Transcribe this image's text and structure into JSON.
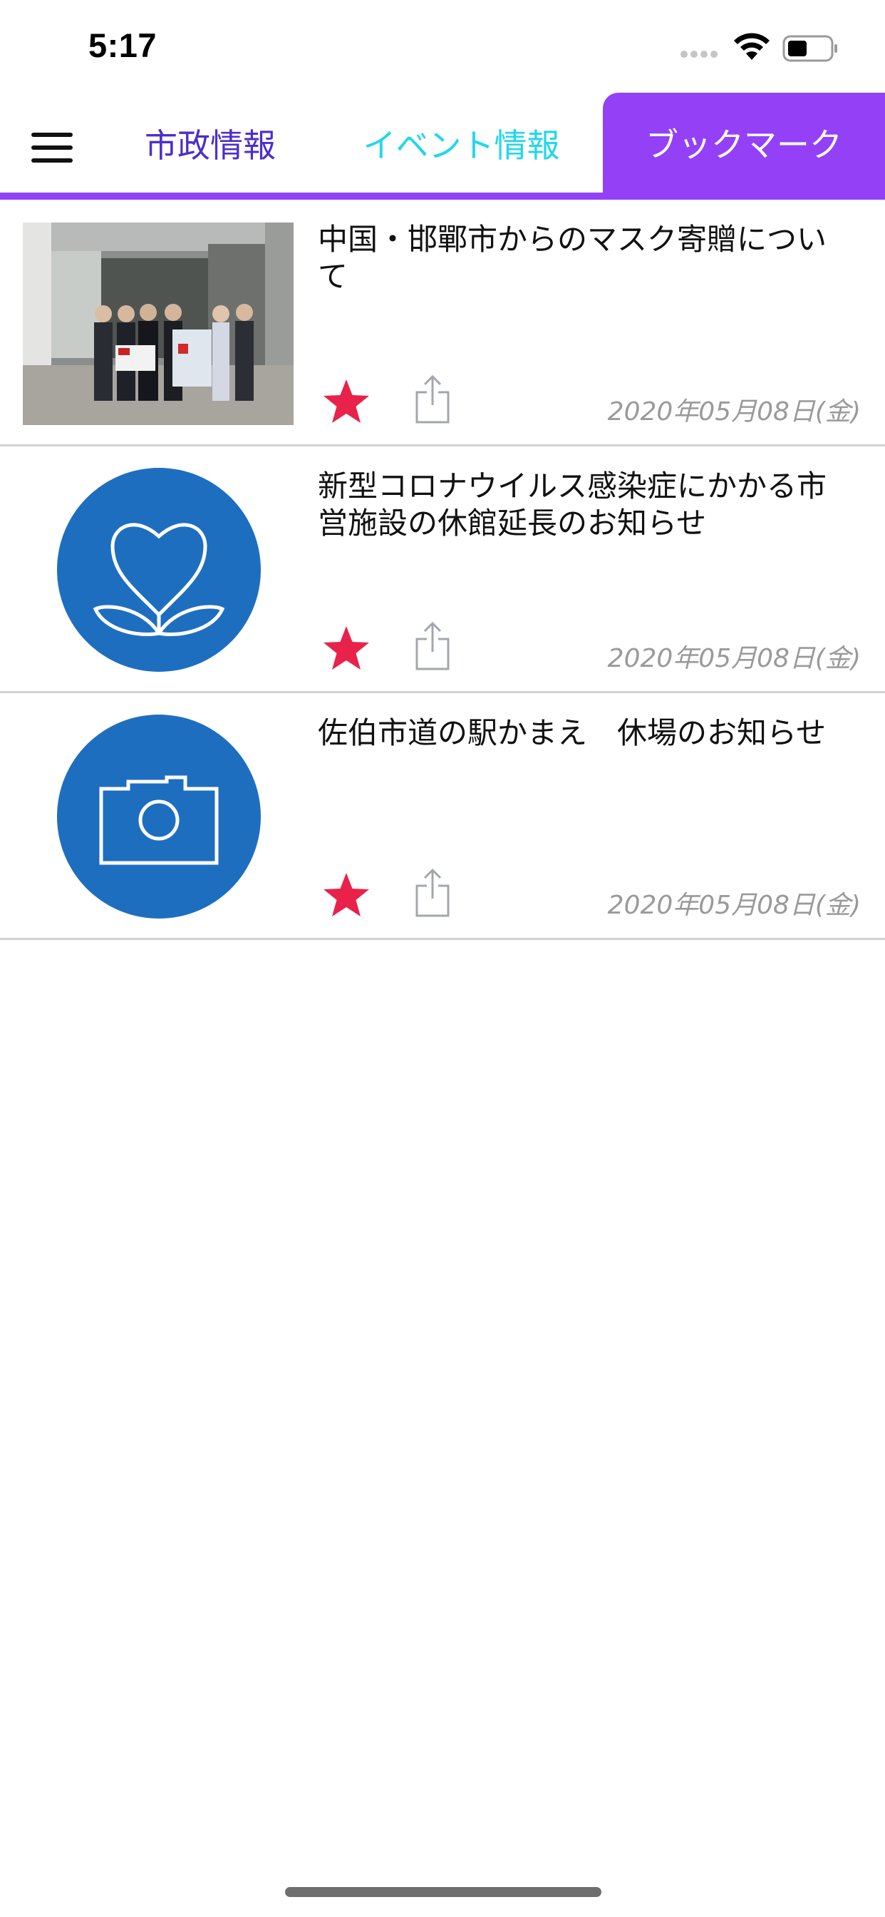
{
  "status_bar": {
    "time": "5:17",
    "icons": [
      "signal-dots-icon",
      "wifi-icon",
      "battery-icon"
    ]
  },
  "nav": {
    "menu_icon": "hamburger-menu-icon",
    "tabs": [
      {
        "label": "市政情報",
        "color": "#4b2fcc",
        "selected": false
      },
      {
        "label": "イベント情報",
        "color": "#21d7ea",
        "selected": false
      },
      {
        "label": "ブックマーク",
        "color": "#ffffff",
        "selected": true
      }
    ],
    "accent_color": "#9340f7"
  },
  "items": [
    {
      "title": "中国・邯鄲市からのマスク寄贈について",
      "date": "2020年05月08日(金)",
      "thumbnail": "photo",
      "bookmarked": true
    },
    {
      "title": "新型コロナウイルス感染症にかかる市営施設の休館延長のお知らせ",
      "date": "2020年05月08日(金)",
      "thumbnail": "flower-icon",
      "bookmarked": true
    },
    {
      "title": "佐伯市道の駅かまえ　休場のお知らせ",
      "date": "2020年05月08日(金)",
      "thumbnail": "camera-icon",
      "bookmarked": true
    }
  ],
  "colors": {
    "star": "#e8224a",
    "thumbnail_circle": "#1e6ec0",
    "date_text": "#9a9a9a"
  }
}
